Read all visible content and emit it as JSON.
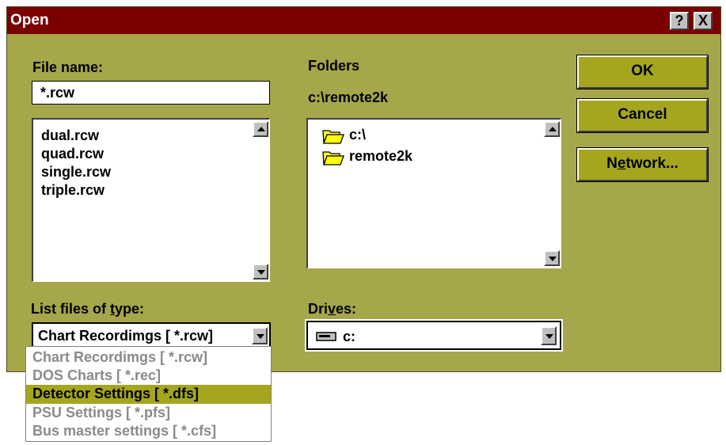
{
  "window": {
    "title": "Open",
    "help_label": "?",
    "close_label": "X"
  },
  "file_name": {
    "label": "File name:",
    "value": "*.rcw",
    "files": [
      "dual.rcw",
      "quad.rcw",
      "single.rcw",
      "triple.rcw"
    ]
  },
  "folders": {
    "label": "Folders",
    "current_path": "c:\\remote2k",
    "items": [
      {
        "name": "c:\\",
        "icon": "folder-open-icon"
      },
      {
        "name": "remote2k",
        "icon": "folder-open-icon"
      }
    ]
  },
  "buttons": {
    "ok": "OK",
    "cancel": "Cancel",
    "network_pre": "N",
    "network_u": "e",
    "network_post": "twork..."
  },
  "file_type": {
    "label_pre": "List files of ",
    "label_u": "t",
    "label_post": "ype:",
    "selected": "Chart Recordimgs [ *.rcw]",
    "options": [
      "Chart Recordimgs [ *.rcw]",
      "DOS Charts [ *.rec]",
      "Detector Settings [ *.dfs]",
      "PSU Settings [ *.pfs]",
      "Bus master settings [ *.cfs]"
    ],
    "highlighted_index": 2
  },
  "drives": {
    "label_pre": "Dri",
    "label_u": "v",
    "label_post": "es:",
    "selected": "c:",
    "icon": "hard-drive-icon"
  },
  "colors": {
    "dialog_bg": "#a6a64b",
    "title_bar": "#7b0000",
    "button_face": "#a6a61e",
    "highlight": "#a6a61e"
  }
}
